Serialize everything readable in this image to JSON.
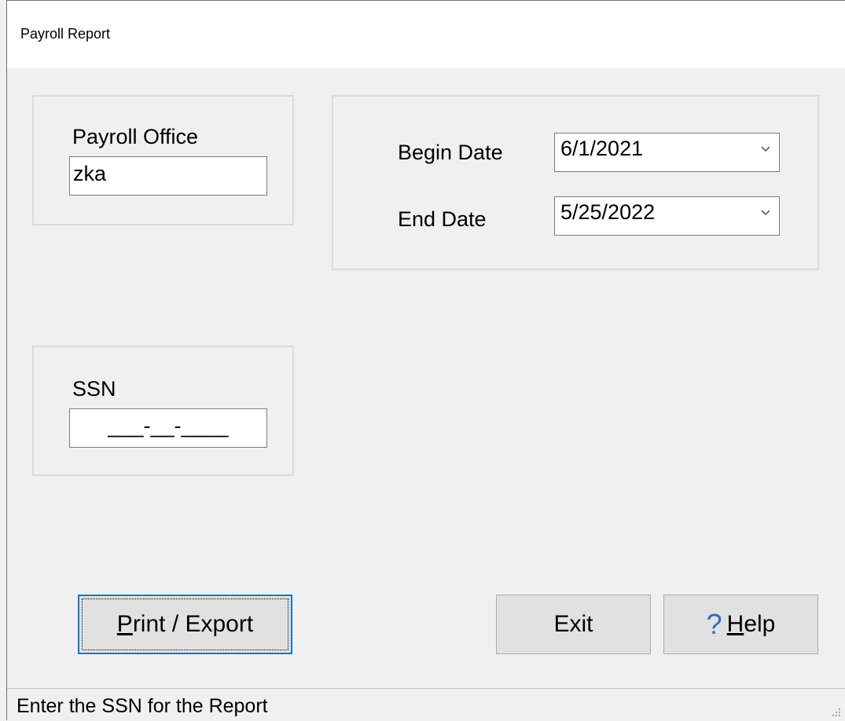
{
  "window": {
    "title": "Payroll Report"
  },
  "payroll_office": {
    "label": "Payroll Office",
    "value": "zka"
  },
  "dates": {
    "begin_label": "Begin Date",
    "begin_value": "6/1/2021",
    "end_label": "End Date",
    "end_value": "5/25/2022"
  },
  "ssn": {
    "label": "SSN",
    "mask": "___-__-____"
  },
  "buttons": {
    "print_export_mnemonic": "P",
    "print_export_rest": "rint / Export",
    "exit": "Exit",
    "help_icon": "?",
    "help_mnemonic": "H",
    "help_rest": "elp"
  },
  "status": {
    "text": "Enter the SSN for the Report"
  },
  "icons": {
    "dropdown": "chevron-down-icon",
    "help": "question-mark-icon",
    "resize": "resize-grip-icon"
  },
  "colors": {
    "accent": "#0078d7",
    "help_icon": "#2f6fc6",
    "background": "#f0f0f0"
  }
}
